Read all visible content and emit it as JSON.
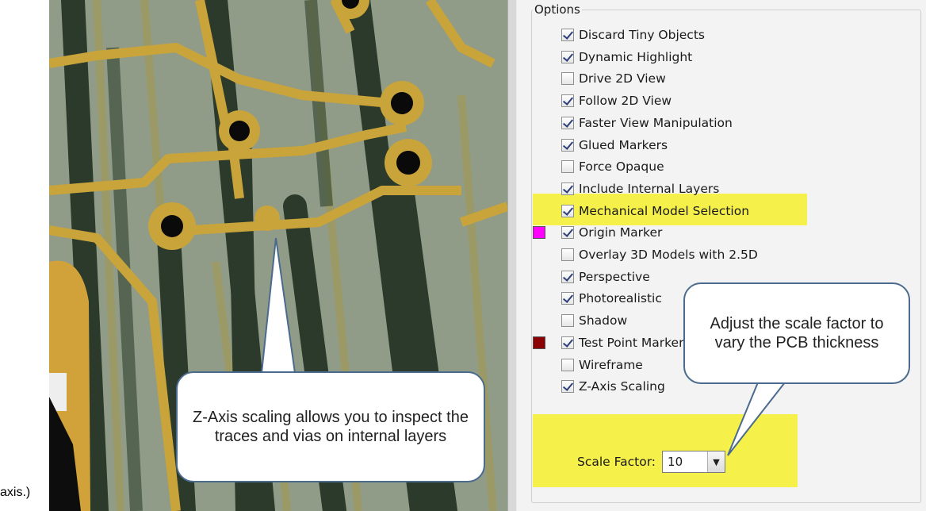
{
  "caption_fragment": "axis.)",
  "options": {
    "title": "Options",
    "items": [
      {
        "label": "Discard Tiny Objects",
        "checked": true
      },
      {
        "label": "Dynamic Highlight",
        "checked": true
      },
      {
        "label": "Drive 2D View",
        "checked": false
      },
      {
        "label": "Follow 2D View",
        "checked": true
      },
      {
        "label": "Faster View Manipulation",
        "checked": true
      },
      {
        "label": "Glued Markers",
        "checked": true
      },
      {
        "label": "Force Opaque",
        "checked": false
      },
      {
        "label": "Include Internal Layers",
        "checked": true
      },
      {
        "label": "Mechanical Model Selection",
        "checked": true
      },
      {
        "label": "Origin Marker",
        "checked": true,
        "swatch": "#ff00ff"
      },
      {
        "label": "Overlay 3D Models with 2.5D",
        "checked": false
      },
      {
        "label": "Perspective",
        "checked": true
      },
      {
        "label": "Photorealistic",
        "checked": true
      },
      {
        "label": "Shadow",
        "checked": false
      },
      {
        "label": "Test Point Markers",
        "checked": true,
        "swatch": "#8b0000"
      },
      {
        "label": "Wireframe",
        "checked": false
      },
      {
        "label": "Z-Axis Scaling",
        "checked": true
      }
    ],
    "scale_factor_label": "Scale Factor:",
    "scale_factor_value": "10"
  },
  "callouts": {
    "left": "Z-Axis scaling allows you to inspect the traces and vias on internal layers",
    "right": "Adjust the scale factor to vary the PCB thickness"
  },
  "colors": {
    "highlight": "#f6f04a",
    "trace": "#c9a43a",
    "board": "#8f9b86",
    "via_column": "#2f3f2f",
    "callout_border": "#4a6b8e"
  }
}
